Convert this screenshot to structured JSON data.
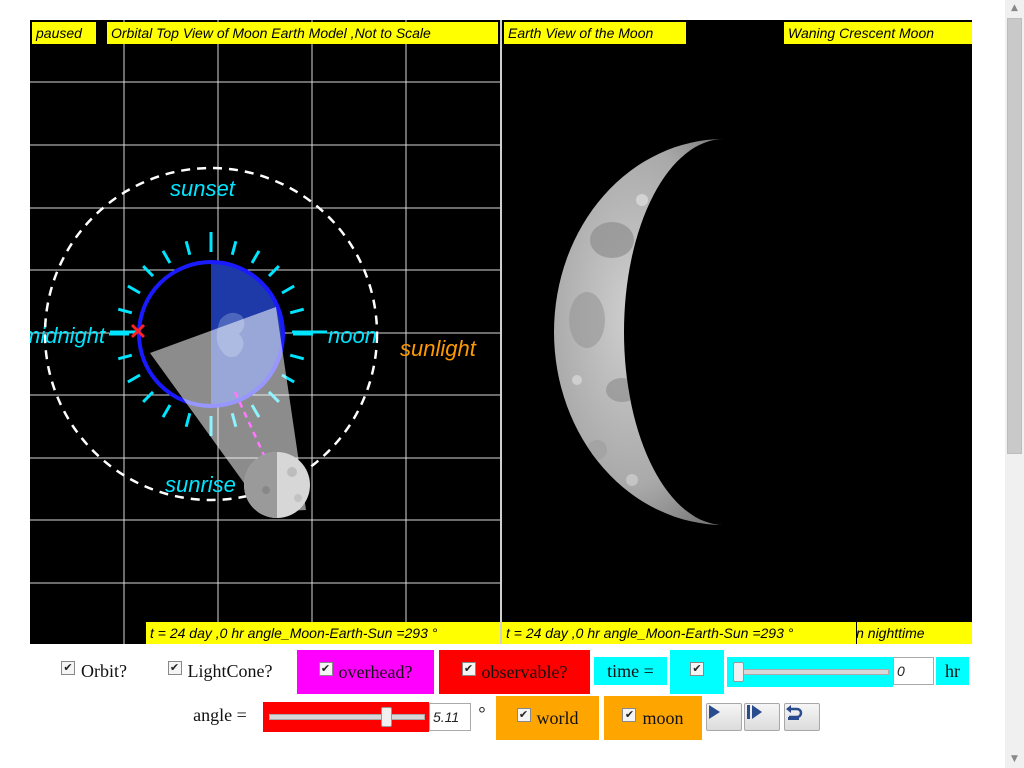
{
  "left_view": {
    "status": "paused",
    "title": "Orbital Top View of Moon Earth Model ,Not to Scale",
    "labels": {
      "sunset": "sunset",
      "midnight": "midnight",
      "noon": "noon",
      "sunlight": "sunlight",
      "sunrise": "sunrise"
    },
    "readout": "t = 24 day ,0 hr angle_Moon-Earth-Sun =293 °"
  },
  "right_view": {
    "title": "Earth View of the Moon",
    "phase": "Waning Crescent Moon",
    "readout": "t = 24 day ,0 hr angle_Moon-Earth-Sun =293 °",
    "time_of_day": "in nighttime"
  },
  "controls": {
    "orbit_label": "Orbit?",
    "lightcone_label": "LightCone?",
    "overhead_label": "overhead?",
    "observable_label": "observable?",
    "time_label": "time =",
    "time_value": "0",
    "time_unit": "hr",
    "angle_label": "angle =",
    "angle_value": "5.11",
    "angle_unit": "°",
    "world_label": "world",
    "moon_label": "moon",
    "orbit_checked": true,
    "lightcone_checked": true,
    "overhead_checked": true,
    "observable_checked": true,
    "time_checked": true,
    "world_checked": true,
    "moon_checked": true,
    "time_slider_fraction": 0.0,
    "angle_slider_fraction": 0.78
  },
  "colors": {
    "label_bg": "#ffff00",
    "overhead_bg": "#ff00ff",
    "observable_bg": "#ff0000",
    "time_bg": "#00ffff",
    "world_bg": "#ffa500",
    "angle_slider_bg": "#ff0000",
    "sunlight_text": "#ff9900",
    "marker_text": "#00e5ff",
    "earth_ring": "#1a1aff"
  },
  "icons": {
    "play": "play-icon",
    "step": "step-forward-icon",
    "reset": "reset-icon",
    "check": "checkmark-icon"
  }
}
